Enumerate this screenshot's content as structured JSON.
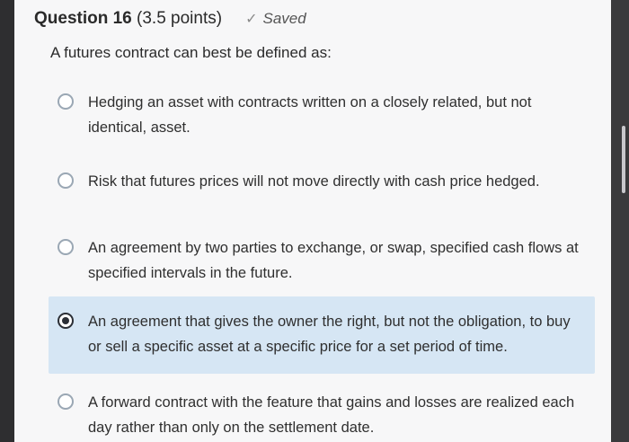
{
  "question": {
    "title": "Question 16",
    "points": "(3.5 points)",
    "status": "Saved",
    "status_icon": "check-icon",
    "prompt": "A futures contract can best be defined as:"
  },
  "options": [
    {
      "text": "Hedging an asset with contracts written on a closely related, but not identical, asset.",
      "selected": false
    },
    {
      "text": "Risk that futures prices will not move directly with cash price hedged.",
      "selected": false
    },
    {
      "text": "An agreement by two parties to exchange, or swap, specified cash flows at specified intervals in the future.",
      "selected": false
    },
    {
      "text": "An agreement that gives the owner the right, but not the obligation, to buy or sell a specific asset at a specific price for a set period of time.",
      "selected": true
    },
    {
      "text": "A forward contract with the feature that gains and losses are realized each day rather than only on the settlement date.",
      "selected": false
    }
  ],
  "colors": {
    "selected_bg": "#d6e6f4",
    "radio_border": "#9aa7b4"
  }
}
